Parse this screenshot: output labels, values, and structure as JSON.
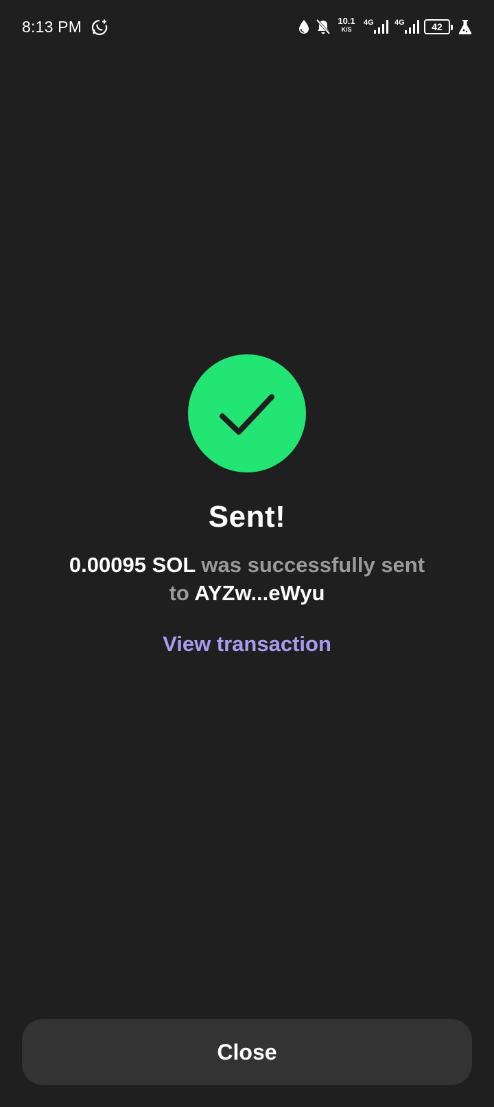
{
  "status_bar": {
    "time": "8:13 PM",
    "net_speed_value": "10.1",
    "net_speed_unit": "K/S",
    "sim1_label": "4G",
    "sim2_label": "4G",
    "battery_level": "42",
    "icons": [
      "whatsapp-icon",
      "water-drop-icon",
      "bell-muted-icon",
      "signal-icon",
      "signal-icon",
      "battery-icon",
      "flask-icon"
    ]
  },
  "success": {
    "icon": "checkmark-icon",
    "icon_bg_color": "#22e574",
    "title": "Sent!",
    "amount": "0.00095 SOL",
    "message_middle": "was successfully sent to",
    "recipient": "AYZw...eWyu",
    "view_transaction_label": "View transaction",
    "link_color": "#a99cf0"
  },
  "footer": {
    "close_label": "Close"
  }
}
